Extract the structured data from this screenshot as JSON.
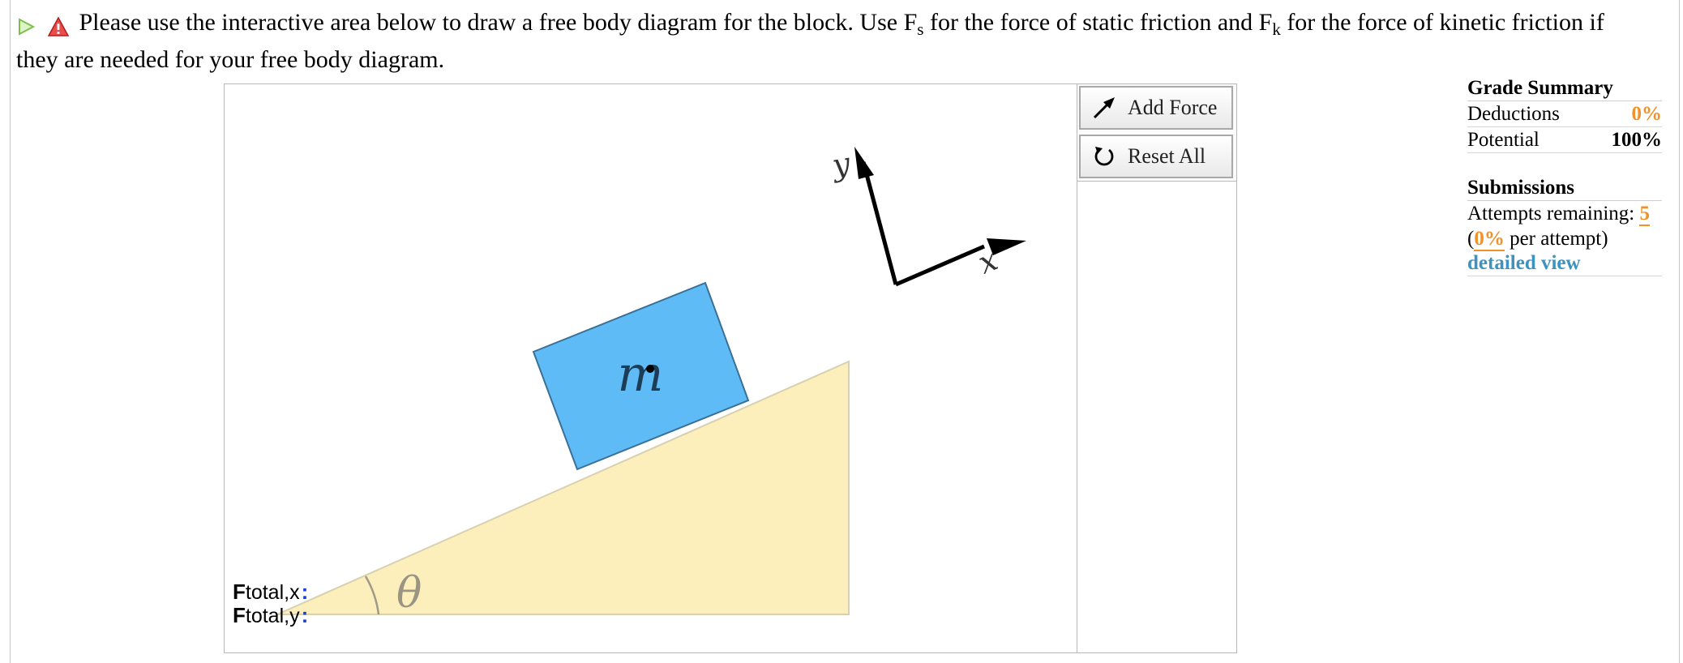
{
  "prompt": {
    "text_a": "Please use the interactive area below to draw a free body diagram for the block. Use F",
    "sub_s": "s",
    "text_b": " for the force of static friction and F",
    "sub_k": "k",
    "text_c": " for the force of kinetic friction if they are needed for your free body diagram."
  },
  "diagram": {
    "mass_label": "m",
    "angle_label": "θ",
    "axis_y": "y",
    "axis_x": "x"
  },
  "toolbar": {
    "add_force": "Add Force",
    "reset_all": "Reset All"
  },
  "totals": {
    "fx_main": "F",
    "fx_sub": "total,x",
    "fy_main": "F",
    "fy_sub": "total,y",
    "colon": ":"
  },
  "grade_summary": {
    "heading": "Grade Summary",
    "deductions_label": "Deductions",
    "deductions_value": "0%",
    "potential_label": "Potential",
    "potential_value": "100%"
  },
  "submissions": {
    "heading": "Submissions",
    "attempts_label": "Attempts remaining:",
    "attempts_value": "5",
    "per_attempt_open": "(",
    "per_attempt_value": "0%",
    "per_attempt_text": " per attempt)",
    "detailed_link": "detailed view"
  },
  "colors": {
    "block": "#5fbbf5",
    "incline": "#fcefbb",
    "accent": "#f0922a",
    "link": "#3b93bf"
  },
  "icons": {
    "play": "play-icon",
    "warning": "warning-icon",
    "arrow": "arrow-icon",
    "reset": "reset-icon"
  }
}
